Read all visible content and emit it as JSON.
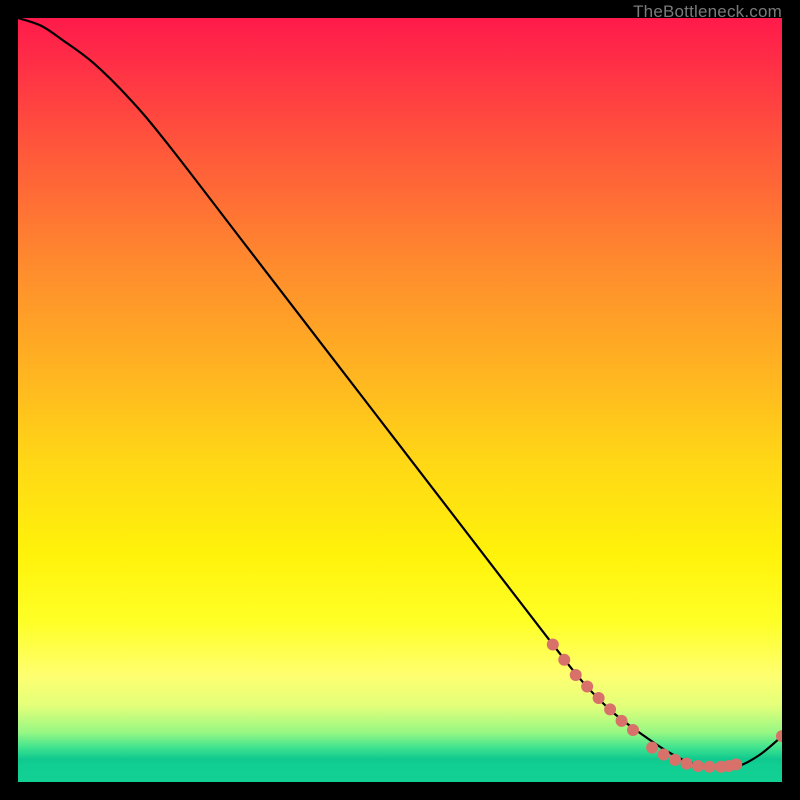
{
  "attribution": "TheBottleneck.com",
  "chart_data": {
    "type": "line",
    "title": "",
    "xlabel": "",
    "ylabel": "",
    "xlim": [
      0,
      100
    ],
    "ylim": [
      0,
      100
    ],
    "grid": false,
    "legend": false,
    "curve": {
      "name": "bottleneck-curve",
      "color": "#000000",
      "x": [
        0,
        3,
        6,
        10,
        15,
        20,
        30,
        40,
        50,
        60,
        70,
        74,
        78,
        82,
        85,
        88,
        91,
        94,
        97,
        100
      ],
      "y": [
        100,
        99,
        97,
        94,
        89,
        83,
        70,
        57,
        44,
        31,
        18,
        13,
        9,
        6,
        4,
        2.5,
        2,
        2,
        3.5,
        6
      ]
    },
    "marker_groups": [
      {
        "name": "cluster-diagonal",
        "color": "#d9716b",
        "radius": 6,
        "points": [
          {
            "x": 70.0,
            "y": 18.0
          },
          {
            "x": 71.5,
            "y": 16.0
          },
          {
            "x": 73.0,
            "y": 14.0
          },
          {
            "x": 74.5,
            "y": 12.5
          },
          {
            "x": 76.0,
            "y": 11.0
          },
          {
            "x": 77.5,
            "y": 9.5
          },
          {
            "x": 79.0,
            "y": 8.0
          },
          {
            "x": 80.5,
            "y": 6.8
          }
        ]
      },
      {
        "name": "cluster-bottom",
        "color": "#d9716b",
        "radius": 6,
        "points": [
          {
            "x": 83.0,
            "y": 4.5
          },
          {
            "x": 84.5,
            "y": 3.6
          },
          {
            "x": 86.0,
            "y": 2.9
          },
          {
            "x": 87.5,
            "y": 2.4
          },
          {
            "x": 89.0,
            "y": 2.1
          },
          {
            "x": 90.5,
            "y": 2.0
          },
          {
            "x": 92.0,
            "y": 2.0
          },
          {
            "x": 93.0,
            "y": 2.1
          },
          {
            "x": 94.0,
            "y": 2.3
          }
        ]
      },
      {
        "name": "tail-point",
        "color": "#d9716b",
        "radius": 6,
        "points": [
          {
            "x": 100.0,
            "y": 6.0
          }
        ]
      }
    ]
  }
}
